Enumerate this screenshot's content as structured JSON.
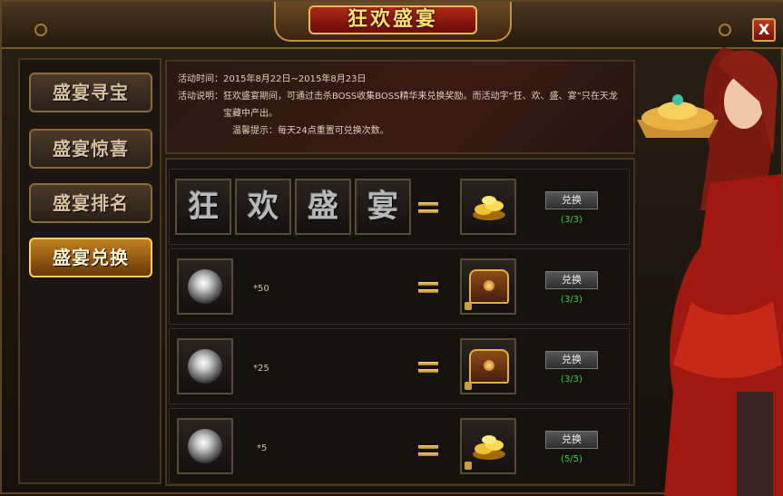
{
  "window": {
    "title": "狂欢盛宴",
    "close_label": "X"
  },
  "sidebar": {
    "items": [
      {
        "label": "盛宴寻宝",
        "active": false
      },
      {
        "label": "盛宴惊喜",
        "active": false
      },
      {
        "label": "盛宴排名",
        "active": false
      },
      {
        "label": "盛宴兑换",
        "active": true
      }
    ]
  },
  "info": {
    "time_label": "活动时间：",
    "time_value": "2015年8月22日~2015年8月23日",
    "desc_label": "活动说明：",
    "desc_value": "狂欢盛宴期间，可通过击杀BOSS收集BOSS精华来兑换奖励。而活动字“狂、欢、盛、宴”只在天龙宝藏中产出。",
    "tip": "温馨提示：每天24点重置可兑换次数。"
  },
  "exchange": {
    "rows": [
      {
        "inputs": [
          "狂",
          "欢",
          "盛",
          "宴"
        ],
        "quantity": "",
        "reward": "gold-ingot-icon",
        "button": "兑换",
        "count": "(3/3)"
      },
      {
        "inputs": [
          "boss-essence-icon"
        ],
        "quantity": "*50",
        "reward": "treasure-chest-icon",
        "button": "兑换",
        "count": "(3/3)"
      },
      {
        "inputs": [
          "boss-essence-icon"
        ],
        "quantity": "*25",
        "reward": "treasure-chest-icon",
        "button": "兑换",
        "count": "(3/3)"
      },
      {
        "inputs": [
          "boss-essence-icon"
        ],
        "quantity": "*5",
        "reward": "gold-ingot-icon",
        "button": "兑换",
        "count": "(5/5)"
      }
    ],
    "equals_icon": "equals-icon"
  },
  "colors": {
    "accent": "#ffd060",
    "count_green": "#30d040",
    "title_red": "#b02818"
  }
}
